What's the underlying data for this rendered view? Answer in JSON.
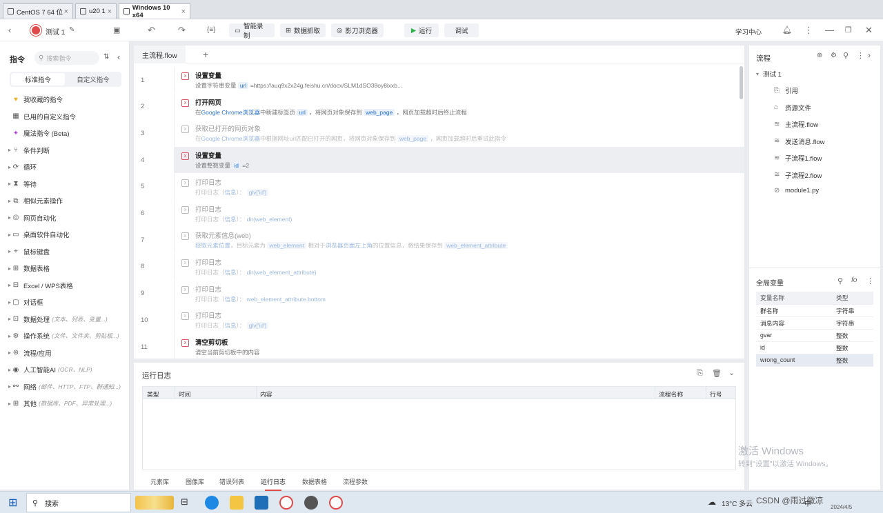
{
  "vm_tabs": [
    {
      "label": "CentOS 7 64 位"
    },
    {
      "label": "u20 1"
    },
    {
      "label": "Windows 10 x64"
    }
  ],
  "toolbar": {
    "project_name": "测试 1",
    "smart_record": "智能录制",
    "data_capture": "数据抓取",
    "browser": "影刀浏览器",
    "run": "运行",
    "debug": "调试",
    "learning_center": "学习中心"
  },
  "left": {
    "title": "指令",
    "search_placeholder": "搜索指令",
    "tab_standard": "标准指令",
    "tab_custom": "自定义指令",
    "items": [
      {
        "label": "我收藏的指令",
        "hint": "",
        "icon": "heart-icon"
      },
      {
        "label": "已用的自定义指令",
        "hint": "",
        "icon": "calendar-icon"
      },
      {
        "label": "魔法指令 (Beta)",
        "hint": "",
        "icon": "sparkle-icon"
      },
      {
        "label": "条件判断",
        "hint": "",
        "icon": "branch-icon"
      },
      {
        "label": "循环",
        "hint": "",
        "icon": "loop-icon"
      },
      {
        "label": "等待",
        "hint": "",
        "icon": "hourglass-icon"
      },
      {
        "label": "相似元素操作",
        "hint": "",
        "icon": "copy-icon"
      },
      {
        "label": "网页自动化",
        "hint": "",
        "icon": "globe-icon"
      },
      {
        "label": "桌面软件自动化",
        "hint": "",
        "icon": "monitor-icon"
      },
      {
        "label": "鼠标键盘",
        "hint": "",
        "icon": "mouse-icon"
      },
      {
        "label": "数据表格",
        "hint": "",
        "icon": "table-icon"
      },
      {
        "label": "Excel / WPS表格",
        "hint": "",
        "icon": "excel-icon"
      },
      {
        "label": "对话框",
        "hint": "",
        "icon": "dialog-icon"
      },
      {
        "label": "数据处理",
        "hint": "(文本、列表、变量...)",
        "icon": "data-icon"
      },
      {
        "label": "操作系统",
        "hint": "(文件、文件夹、剪贴板...)",
        "icon": "os-icon"
      },
      {
        "label": "流程/应用",
        "hint": "",
        "icon": "flow-icon"
      },
      {
        "label": "人工智能AI",
        "hint": "(OCR、NLP)",
        "icon": "ai-icon"
      },
      {
        "label": "网络",
        "hint": "(邮件、HTTP、FTP、群通知...)",
        "icon": "network-icon"
      },
      {
        "label": "其他",
        "hint": "(数据库、PDF、异常处理...)",
        "icon": "grid-icon"
      }
    ]
  },
  "center": {
    "flow_tab": "主流程.flow",
    "add_tab": "+",
    "rows": [
      {
        "n": "1",
        "title": "设置变量",
        "desc": [
          [
            "t",
            "设置字符串变量 "
          ],
          [
            "v",
            "url"
          ],
          [
            "t",
            " =https://auq9x2x24g.feishu.cn/docx/SLM1dSO38oy8ixxb..."
          ]
        ],
        "state": "normal"
      },
      {
        "n": "2",
        "title": "打开网页",
        "desc": [
          [
            "t",
            "在"
          ],
          [
            "l",
            "Google Chrome浏览器"
          ],
          [
            "t",
            "中新建标签页 "
          ],
          [
            "v",
            "url"
          ],
          [
            "t",
            " ，将网页对象保存到 "
          ],
          [
            "v",
            "web_page"
          ],
          [
            "t",
            " ，网页加载超时后终止流程"
          ]
        ],
        "state": "normal"
      },
      {
        "n": "3",
        "title": "获取已打开的网页对象",
        "desc": [
          [
            "t",
            "在"
          ],
          [
            "l",
            "Google Chrome浏览器"
          ],
          [
            "t",
            "中根据网址url匹配已打开的网页，将网页对象保存到 "
          ],
          [
            "v",
            "web_page"
          ],
          [
            "t",
            " ，网页加载超时后重试此指令"
          ]
        ],
        "state": "disabled"
      },
      {
        "n": "4",
        "title": "设置变量",
        "desc": [
          [
            "t",
            "设置整数变量 "
          ],
          [
            "v",
            "id"
          ],
          [
            "t",
            " =2"
          ]
        ],
        "state": "selected"
      },
      {
        "n": "5",
        "title": "打印日志",
        "desc": [
          [
            "t",
            "打印日志（"
          ],
          [
            "l",
            "信息"
          ],
          [
            "t",
            "）： "
          ],
          [
            "v",
            "glv['id']"
          ]
        ],
        "state": "disabled"
      },
      {
        "n": "6",
        "title": "打印日志",
        "desc": [
          [
            "t",
            "打印日志（"
          ],
          [
            "l",
            "信息"
          ],
          [
            "t",
            "）： "
          ],
          [
            "l",
            "dir(web_element)"
          ]
        ],
        "state": "disabled"
      },
      {
        "n": "7",
        "title": "获取元素信息(web)",
        "desc": [
          [
            "l",
            "获取元素位置"
          ],
          [
            "t",
            "，目标元素为 "
          ],
          [
            "v",
            "web_element"
          ],
          [
            "t",
            " 相对于"
          ],
          [
            "l",
            "浏览器页面左上角"
          ],
          [
            "t",
            "的位置信息，将结果保存到 "
          ],
          [
            "v",
            "web_element_attribute"
          ]
        ],
        "state": "disabled"
      },
      {
        "n": "8",
        "title": "打印日志",
        "desc": [
          [
            "t",
            "打印日志（"
          ],
          [
            "l",
            "信息"
          ],
          [
            "t",
            "）： "
          ],
          [
            "l",
            "dir(web_element_attribute)"
          ]
        ],
        "state": "disabled"
      },
      {
        "n": "9",
        "title": "打印日志",
        "desc": [
          [
            "t",
            "打印日志（"
          ],
          [
            "l",
            "信息"
          ],
          [
            "t",
            "）： "
          ],
          [
            "l",
            "web_element_attribute.bottom"
          ]
        ],
        "state": "disabled"
      },
      {
        "n": "10",
        "title": "打印日志",
        "desc": [
          [
            "t",
            "打印日志（"
          ],
          [
            "l",
            "信息"
          ],
          [
            "t",
            "）： "
          ],
          [
            "v",
            "glv['id']"
          ]
        ],
        "state": "disabled"
      },
      {
        "n": "11",
        "title": "清空剪切板",
        "desc": [
          [
            "t",
            "清空当前剪切板中的内容"
          ]
        ],
        "state": "normal"
      }
    ]
  },
  "log": {
    "title": "运行日志",
    "columns": [
      "类型",
      "时间",
      "内容",
      "流程名称",
      "行号"
    ],
    "bottom_tabs": [
      "元素库",
      "图像库",
      "错误列表",
      "运行日志",
      "数据表格",
      "流程参数"
    ],
    "active_bottom_tab": "运行日志"
  },
  "right": {
    "flow_title": "流程",
    "root": "测试 1",
    "tree": [
      {
        "label": "引用",
        "icon": "link-icon"
      },
      {
        "label": "资源文件",
        "icon": "folder-icon"
      },
      {
        "label": "主流程.flow",
        "icon": "layers-icon"
      },
      {
        "label": "发送消息.flow",
        "icon": "layers-icon"
      },
      {
        "label": "子流程1.flow",
        "icon": "layers-icon"
      },
      {
        "label": "子流程2.flow",
        "icon": "layers-icon"
      },
      {
        "label": "module1.py",
        "icon": "python-icon"
      }
    ],
    "vars_title": "全局变量",
    "var_headers": [
      "变量名称",
      "类型"
    ],
    "vars": [
      {
        "name": "群名称",
        "type": "字符串"
      },
      {
        "name": "消息内容",
        "type": "字符串"
      },
      {
        "name": "gvar",
        "type": "整数"
      },
      {
        "name": "id",
        "type": "整数"
      },
      {
        "name": "wrong_count",
        "type": "整数"
      }
    ]
  },
  "watermark": {
    "line1": "激活 Windows",
    "line2": "转到\"设置\"以激活 Windows。"
  },
  "taskbar": {
    "search": "搜索",
    "weather": "13°C 多云",
    "csdn": "CSDN @雨过微凉",
    "ime": "中",
    "date": "2024/4/5"
  }
}
